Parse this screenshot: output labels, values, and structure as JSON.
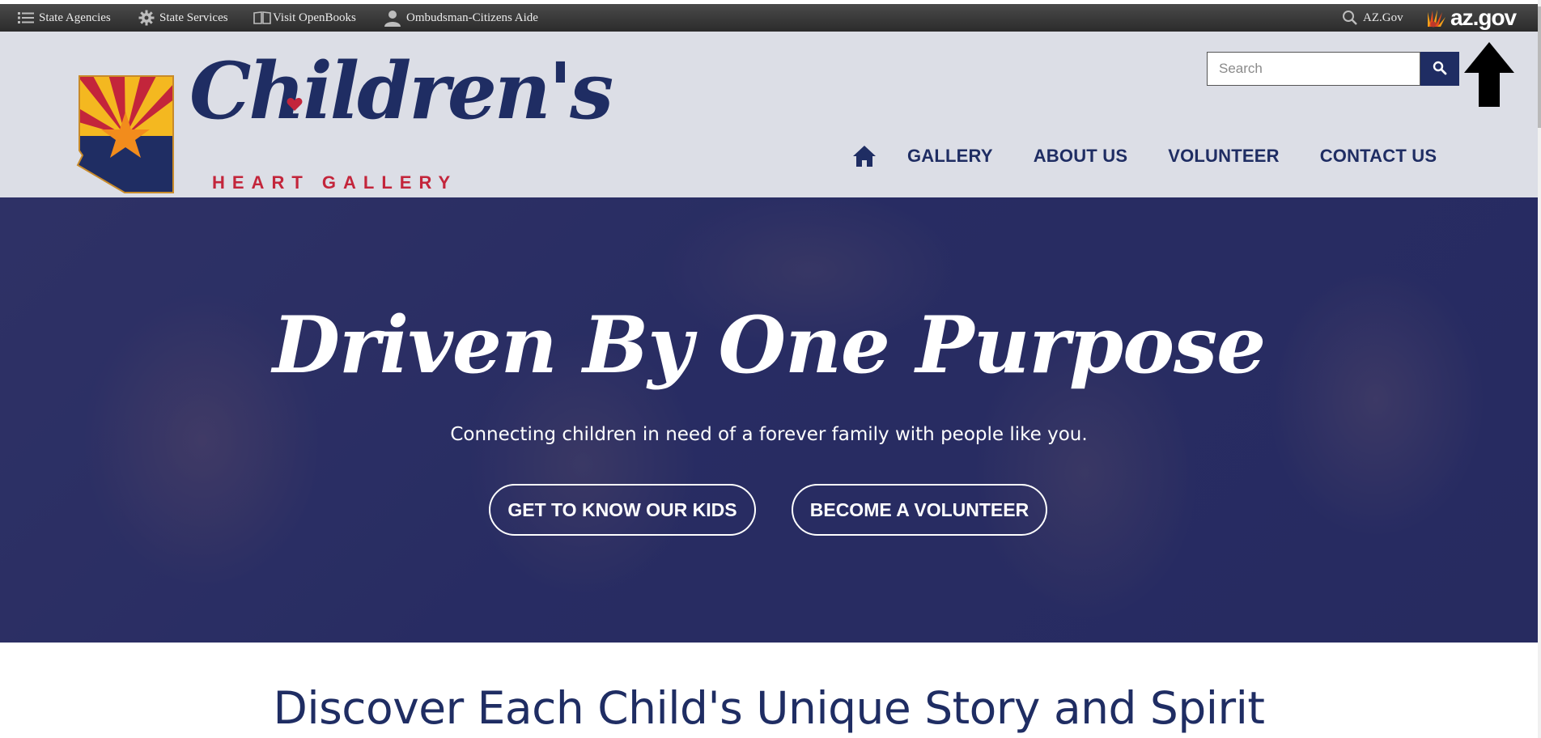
{
  "statebar": {
    "items": [
      {
        "label": "State Agencies",
        "icon": "list-icon"
      },
      {
        "label": "State Services",
        "icon": "gear-icon"
      },
      {
        "label": "Visit OpenBooks",
        "icon": "book-icon"
      },
      {
        "label": "Ombudsman-Citizens Aide",
        "icon": "person-icon"
      }
    ],
    "azgov_link": "AZ.Gov",
    "azgov_logo_text": "az.gov"
  },
  "header": {
    "logo": {
      "script": "Children's",
      "sub": "HEART GALLERY"
    },
    "search": {
      "placeholder": "Search",
      "button_icon": "search-icon"
    },
    "nav": {
      "home_icon": "home-icon",
      "links": [
        "GALLERY",
        "ABOUT US",
        "VOLUNTEER",
        "CONTACT US"
      ]
    }
  },
  "hero": {
    "headline": "Driven By One Purpose",
    "tagline": "Connecting children in need of a forever family with people like you.",
    "buttons": [
      "GET TO KNOW OUR KIDS",
      "BECOME A VOLUNTEER"
    ]
  },
  "section": {
    "heading": "Discover Each Child's Unique Story and Spirit"
  },
  "colors": {
    "navy": "#1f2d63",
    "red": "#c3253b",
    "header_bg": "#dcdee6",
    "statebar_bg": "#333333"
  }
}
